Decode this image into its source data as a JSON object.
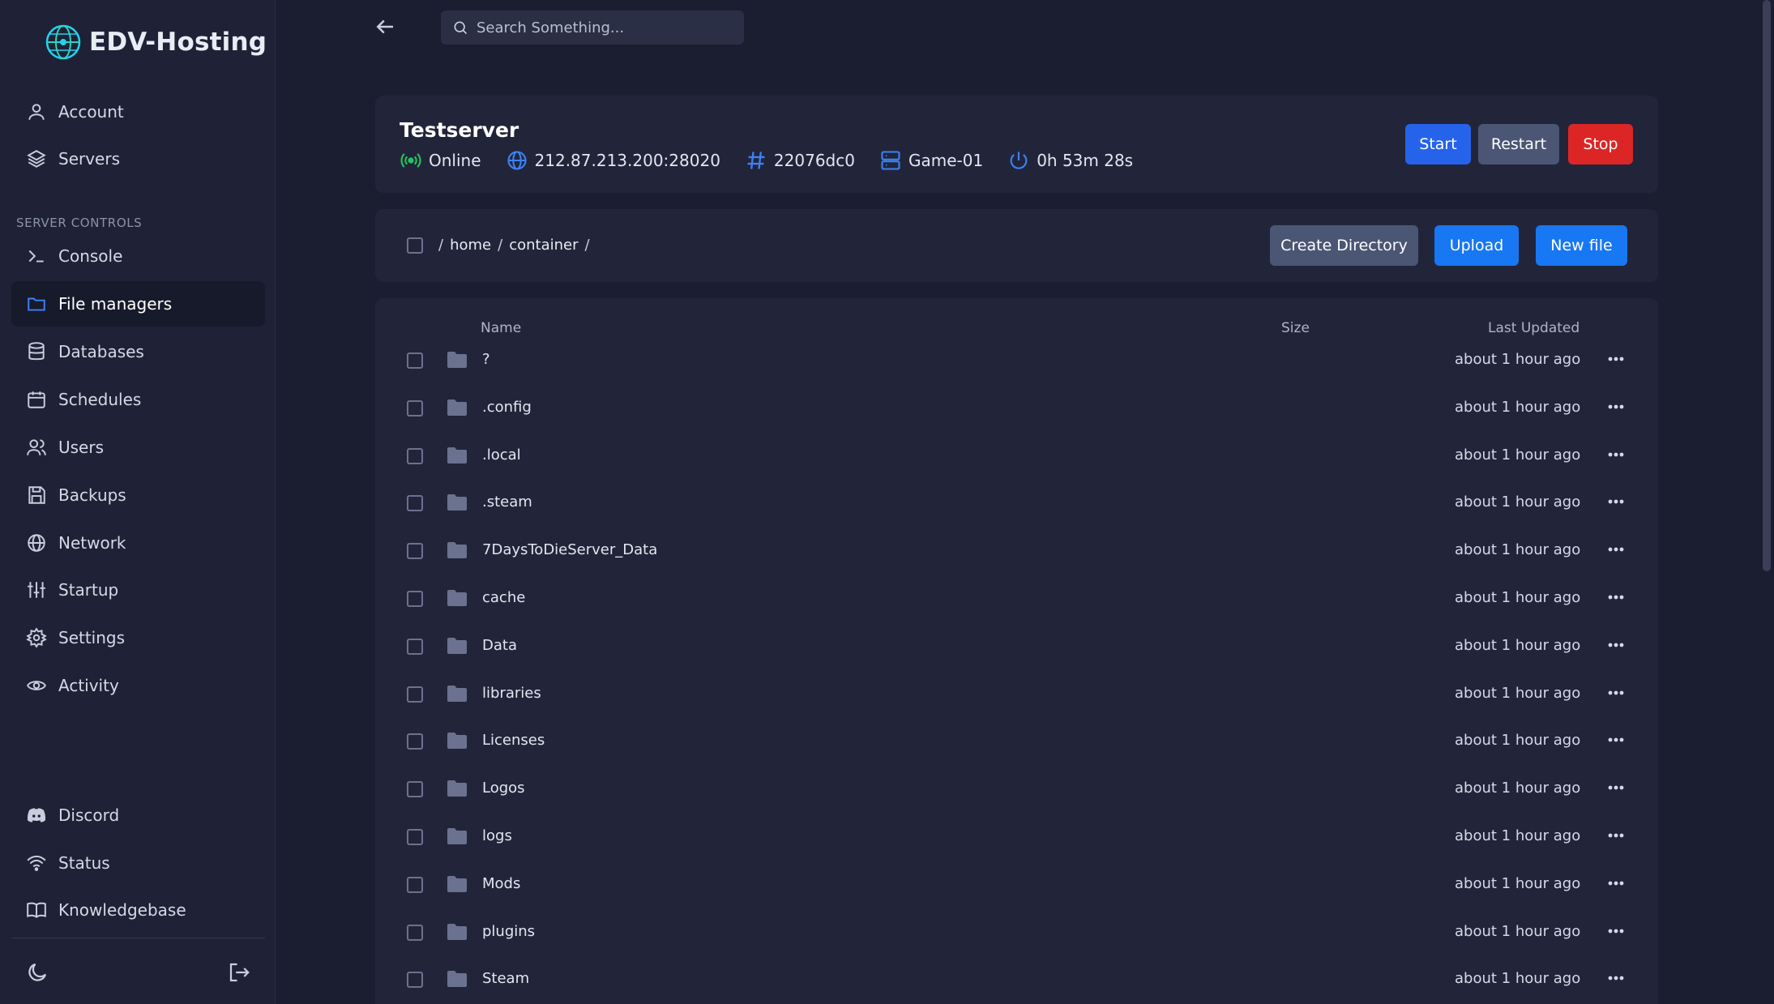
{
  "brand": {
    "name": "EDV-Hosting"
  },
  "sidebar": {
    "top_items": [
      {
        "label": "Account",
        "icon": "user-icon"
      },
      {
        "label": "Servers",
        "icon": "layers-icon"
      }
    ],
    "section_label": "SERVER CONTROLS",
    "control_items": [
      {
        "label": "Console",
        "icon": "terminal-icon"
      },
      {
        "label": "File managers",
        "icon": "folder-icon",
        "active": true
      },
      {
        "label": "Databases",
        "icon": "database-icon"
      },
      {
        "label": "Schedules",
        "icon": "calendar-icon"
      },
      {
        "label": "Users",
        "icon": "users-icon"
      },
      {
        "label": "Backups",
        "icon": "save-icon"
      },
      {
        "label": "Network",
        "icon": "globe-icon"
      },
      {
        "label": "Startup",
        "icon": "sliders-icon"
      },
      {
        "label": "Settings",
        "icon": "gear-icon"
      },
      {
        "label": "Activity",
        "icon": "eye-icon"
      }
    ],
    "footer_items": [
      {
        "label": "Discord",
        "icon": "discord-icon"
      },
      {
        "label": "Status",
        "icon": "wifi-icon"
      },
      {
        "label": "Knowledgebase",
        "icon": "book-icon"
      }
    ]
  },
  "search": {
    "placeholder": "Search Something..."
  },
  "server": {
    "name": "Testserver",
    "status": "Online",
    "address": "212.87.213.200:28020",
    "id": "22076dc0",
    "node": "Game-01",
    "uptime": "0h 53m 28s",
    "colors": {
      "online": "#22c55e",
      "accent": "#3b82f6"
    }
  },
  "power": {
    "start": "Start",
    "restart": "Restart",
    "stop": "Stop"
  },
  "path": {
    "sep": "/",
    "segments": [
      "home",
      "container"
    ]
  },
  "file_actions": {
    "create_dir": "Create Directory",
    "upload": "Upload",
    "new_file": "New file"
  },
  "table": {
    "headers": {
      "name": "Name",
      "size": "Size",
      "updated": "Last Updated"
    },
    "rows": [
      {
        "name": "?",
        "updated": "about 1 hour ago"
      },
      {
        "name": ".config",
        "updated": "about 1 hour ago"
      },
      {
        "name": ".local",
        "updated": "about 1 hour ago"
      },
      {
        "name": ".steam",
        "updated": "about 1 hour ago"
      },
      {
        "name": "7DaysToDieServer_Data",
        "updated": "about 1 hour ago"
      },
      {
        "name": "cache",
        "updated": "about 1 hour ago"
      },
      {
        "name": "Data",
        "updated": "about 1 hour ago"
      },
      {
        "name": "libraries",
        "updated": "about 1 hour ago"
      },
      {
        "name": "Licenses",
        "updated": "about 1 hour ago"
      },
      {
        "name": "Logos",
        "updated": "about 1 hour ago"
      },
      {
        "name": "logs",
        "updated": "about 1 hour ago"
      },
      {
        "name": "Mods",
        "updated": "about 1 hour ago"
      },
      {
        "name": "plugins",
        "updated": "about 1 hour ago"
      },
      {
        "name": "Steam",
        "updated": "about 1 hour ago"
      }
    ]
  }
}
